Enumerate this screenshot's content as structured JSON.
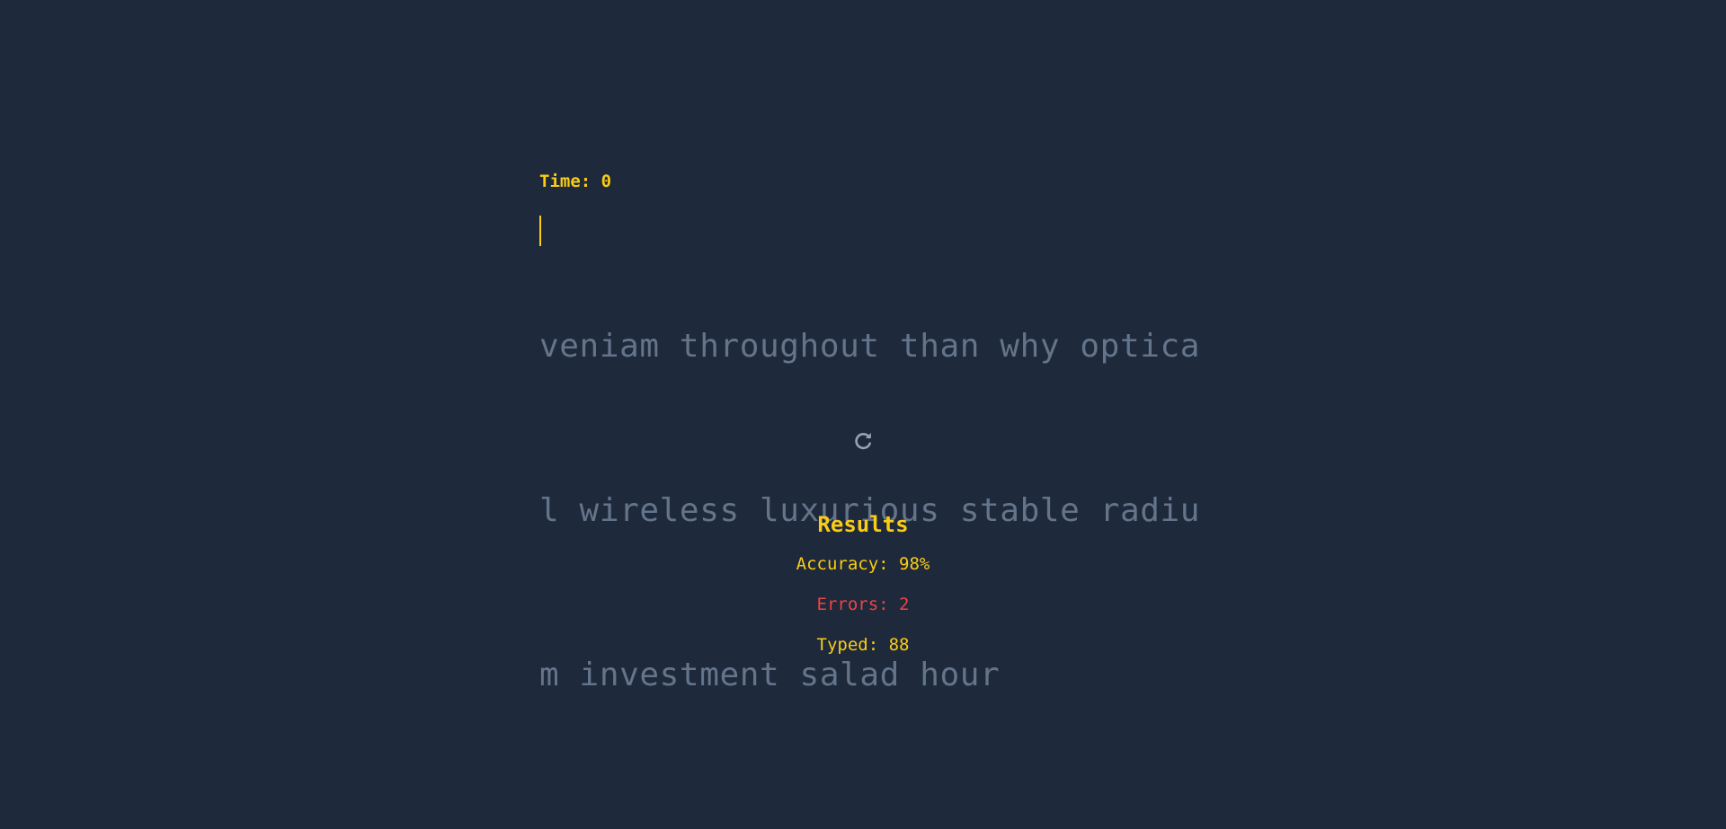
{
  "timer": {
    "label": "Time: 0"
  },
  "typing_text": {
    "lines": [
      "veniam throughout than why optica",
      "l wireless luxurious stable radiu",
      "m investment salad hour"
    ]
  },
  "restart": {
    "icon": "refresh-icon"
  },
  "results": {
    "title": "Results",
    "accuracy": "Accuracy: 98%",
    "errors": "Errors: 2",
    "typed": "Typed: 88"
  },
  "colors": {
    "background": "#1e293b",
    "accent": "#facc15",
    "untyped_text": "#64748b",
    "error": "#ef4444",
    "icon": "#94a3b8"
  }
}
